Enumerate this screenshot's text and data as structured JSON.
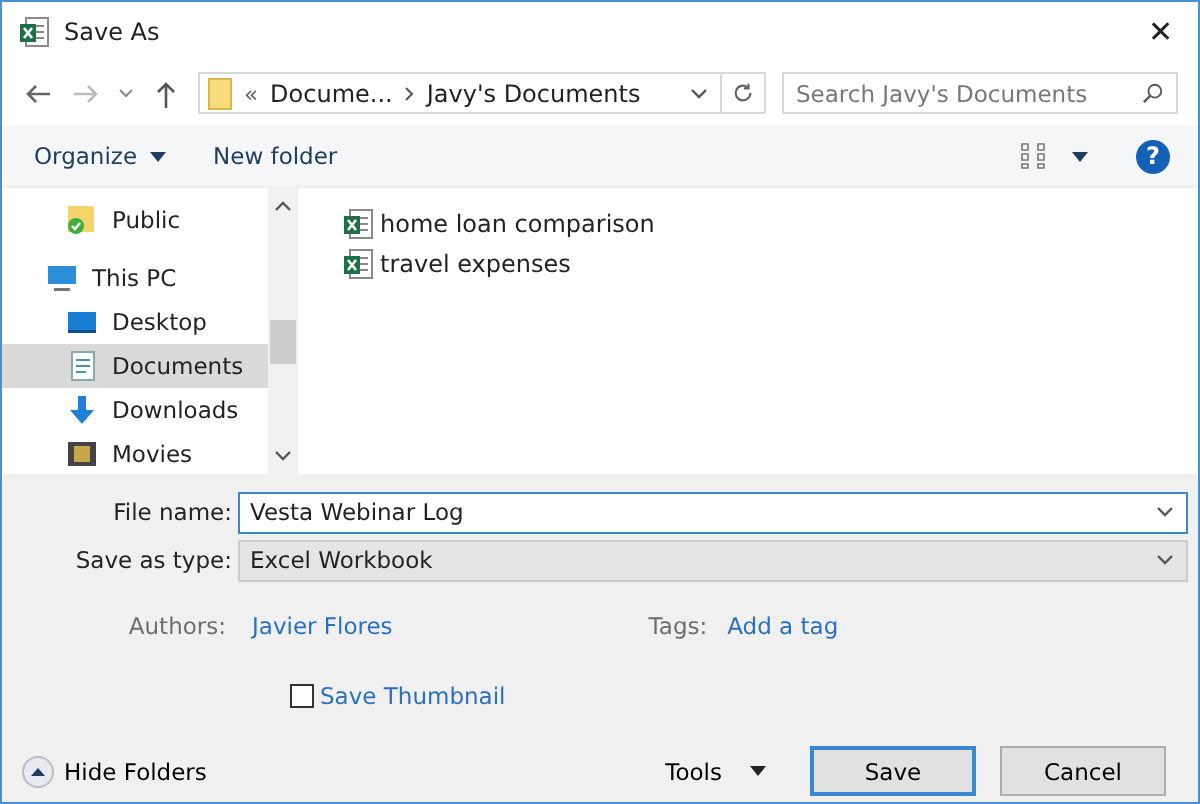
{
  "window": {
    "title": "Save As",
    "close": "✕"
  },
  "nav": {
    "path_prefix": "«",
    "path": [
      "Docume...",
      "Javy's Documents"
    ],
    "search_placeholder": "Search Javy's Documents"
  },
  "toolbar": {
    "organize": "Organize",
    "new_folder": "New folder",
    "help": "?"
  },
  "sidebar": {
    "items": [
      {
        "label": "Public",
        "kind": "public",
        "selected": false
      },
      {
        "label": "This PC",
        "kind": "pc",
        "selected": false
      },
      {
        "label": "Desktop",
        "kind": "desktop",
        "selected": false
      },
      {
        "label": "Documents",
        "kind": "documents",
        "selected": true
      },
      {
        "label": "Downloads",
        "kind": "downloads",
        "selected": false
      },
      {
        "label": "Movies",
        "kind": "movies",
        "selected": false
      }
    ]
  },
  "files": [
    {
      "name": "home loan comparison"
    },
    {
      "name": "travel expenses"
    }
  ],
  "form": {
    "file_name_label": "File name:",
    "file_name": "Vesta Webinar Log",
    "type_label": "Save as type:",
    "type": "Excel Workbook",
    "authors_label": "Authors:",
    "authors": "Javier Flores",
    "tags_label": "Tags:",
    "tags": "Add a tag",
    "thumbnail": {
      "label": "Save Thumbnail",
      "checked": false
    }
  },
  "footer": {
    "hide_folders": "Hide Folders",
    "tools": "Tools",
    "save": "Save",
    "cancel": "Cancel"
  }
}
